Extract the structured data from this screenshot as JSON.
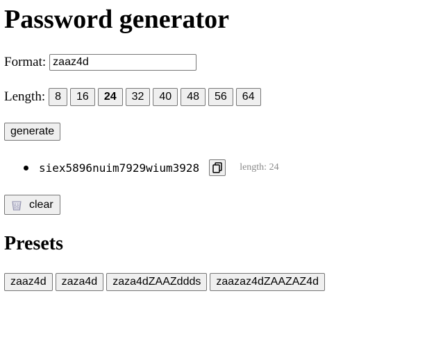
{
  "title": "Password generator",
  "format": {
    "label": "Format:",
    "value": "zaaz4d"
  },
  "length": {
    "label": "Length:",
    "options": [
      "8",
      "16",
      "24",
      "32",
      "40",
      "48",
      "56",
      "64"
    ],
    "selected": "24"
  },
  "generate_label": "generate",
  "results": [
    {
      "password": "siex5896nuim7929wium3928",
      "length_label": "length: 24"
    }
  ],
  "clear_label": "clear",
  "presets": {
    "heading": "Presets",
    "items": [
      "zaaz4d",
      "zaza4d",
      "zaza4dZAAZddds",
      "zaazaz4dZAAZAZ4d"
    ]
  }
}
